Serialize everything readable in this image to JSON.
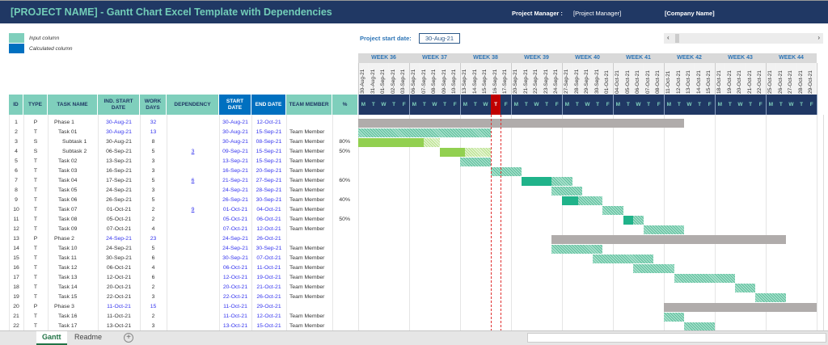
{
  "header": {
    "title": "[PROJECT NAME] - Gantt Chart Excel Template with Dependencies",
    "project_manager_label": "Project Manager :",
    "project_manager_value": "[Project Manager]",
    "company": "[Company Name]"
  },
  "legend": {
    "input_label": "Input column",
    "input_color": "#7fcfbc",
    "calculated_label": "Calculated column",
    "calculated_color": "#0070c0"
  },
  "project_start": {
    "label": "Project start date:",
    "value": "30-Aug-21"
  },
  "scroll": {
    "left": "‹",
    "right": "›"
  },
  "columns": [
    "ID",
    "TYPE",
    "TASK NAME",
    "IND. START DATE",
    "WORK DAYS",
    "DEPENDENCY",
    "START DATE",
    "END DATE",
    "TEAM MEMBER",
    "%"
  ],
  "weeks": [
    "WEEK 36",
    "WEEK 37",
    "WEEK 38",
    "WEEK 39",
    "WEEK 40",
    "WEEK 41",
    "WEEK 42",
    "WEEK 43",
    "WEEK 44"
  ],
  "dates": [
    "30-Aug-21",
    "31-Aug-21",
    "01-Sep-21",
    "02-Sep-21",
    "03-Sep-21",
    "06-Sep-21",
    "07-Sep-21",
    "08-Sep-21",
    "09-Sep-21",
    "10-Sep-21",
    "13-Sep-21",
    "14-Sep-21",
    "15-Sep-21",
    "16-Sep-21",
    "17-Sep-21",
    "20-Sep-21",
    "21-Sep-21",
    "22-Sep-21",
    "23-Sep-21",
    "24-Sep-21",
    "27-Sep-21",
    "28-Sep-21",
    "29-Sep-21",
    "30-Sep-21",
    "01-Oct-21",
    "04-Oct-21",
    "05-Oct-21",
    "06-Oct-21",
    "07-Oct-21",
    "08-Oct-21",
    "11-Oct-21",
    "12-Oct-21",
    "13-Oct-21",
    "14-Oct-21",
    "15-Oct-21",
    "18-Oct-21",
    "19-Oct-21",
    "20-Oct-21",
    "21-Oct-21",
    "22-Oct-21",
    "25-Oct-21",
    "26-Oct-21",
    "27-Oct-21",
    "28-Oct-21",
    "29-Oct-21"
  ],
  "day_letters": [
    "M",
    "T",
    "W",
    "T",
    "F"
  ],
  "today": "16-Sep-21",
  "colors": {
    "phase": "#b0acab",
    "task": "#20b38a",
    "subtask": "#92d050",
    "today": "#c00000",
    "header_bg": "#203864"
  },
  "rows": [
    {
      "id": "1",
      "type": "P",
      "name": "Phase 1",
      "ind_start": "30-Aug-21",
      "work_days": "32",
      "dependency": "",
      "start": "30-Aug-21",
      "end": "12-Oct-21",
      "member": "",
      "pct": "",
      "rollup": true
    },
    {
      "id": "2",
      "type": "T",
      "name": "Task 01",
      "ind_start": "30-Aug-21",
      "work_days": "13",
      "dependency": "",
      "start": "30-Aug-21",
      "end": "15-Sep-21",
      "member": "Team Member",
      "pct": "",
      "rollup": true
    },
    {
      "id": "3",
      "type": "S",
      "name": "Subtask 1",
      "ind_start": "30-Aug-21",
      "work_days": "8",
      "dependency": "",
      "start": "30-Aug-21",
      "end": "08-Sep-21",
      "member": "Team Member",
      "pct": "80%"
    },
    {
      "id": "4",
      "type": "S",
      "name": "Subtask 2",
      "ind_start": "06-Sep-21",
      "work_days": "5",
      "dependency": "3",
      "start": "09-Sep-21",
      "end": "15-Sep-21",
      "member": "Team Member",
      "pct": "50%"
    },
    {
      "id": "5",
      "type": "T",
      "name": "Task 02",
      "ind_start": "13-Sep-21",
      "work_days": "3",
      "dependency": "",
      "start": "13-Sep-21",
      "end": "15-Sep-21",
      "member": "Team Member",
      "pct": ""
    },
    {
      "id": "6",
      "type": "T",
      "name": "Task 03",
      "ind_start": "16-Sep-21",
      "work_days": "3",
      "dependency": "",
      "start": "16-Sep-21",
      "end": "20-Sep-21",
      "member": "Team Member",
      "pct": ""
    },
    {
      "id": "7",
      "type": "T",
      "name": "Task 04",
      "ind_start": "17-Sep-21",
      "work_days": "5",
      "dependency": "6",
      "start": "21-Sep-21",
      "end": "27-Sep-21",
      "member": "Team Member",
      "pct": "60%"
    },
    {
      "id": "8",
      "type": "T",
      "name": "Task 05",
      "ind_start": "24-Sep-21",
      "work_days": "3",
      "dependency": "",
      "start": "24-Sep-21",
      "end": "28-Sep-21",
      "member": "Team Member",
      "pct": ""
    },
    {
      "id": "9",
      "type": "T",
      "name": "Task 06",
      "ind_start": "26-Sep-21",
      "work_days": "5",
      "dependency": "",
      "start": "26-Sep-21",
      "end": "30-Sep-21",
      "member": "Team Member",
      "pct": "40%"
    },
    {
      "id": "10",
      "type": "T",
      "name": "Task 07",
      "ind_start": "01-Oct-21",
      "work_days": "2",
      "dependency": "9",
      "start": "01-Oct-21",
      "end": "04-Oct-21",
      "member": "Team Member",
      "pct": ""
    },
    {
      "id": "11",
      "type": "T",
      "name": "Task 08",
      "ind_start": "05-Oct-21",
      "work_days": "2",
      "dependency": "",
      "start": "05-Oct-21",
      "end": "06-Oct-21",
      "member": "Team Member",
      "pct": "50%"
    },
    {
      "id": "12",
      "type": "T",
      "name": "Task 09",
      "ind_start": "07-Oct-21",
      "work_days": "4",
      "dependency": "",
      "start": "07-Oct-21",
      "end": "12-Oct-21",
      "member": "Team Member",
      "pct": ""
    },
    {
      "id": "13",
      "type": "P",
      "name": "Phase 2",
      "ind_start": "24-Sep-21",
      "work_days": "23",
      "dependency": "",
      "start": "24-Sep-21",
      "end": "26-Oct-21",
      "member": "",
      "pct": "",
      "rollup": true
    },
    {
      "id": "14",
      "type": "T",
      "name": "Task 10",
      "ind_start": "24-Sep-21",
      "work_days": "5",
      "dependency": "",
      "start": "24-Sep-21",
      "end": "30-Sep-21",
      "member": "Team Member",
      "pct": ""
    },
    {
      "id": "15",
      "type": "T",
      "name": "Task 11",
      "ind_start": "30-Sep-21",
      "work_days": "6",
      "dependency": "",
      "start": "30-Sep-21",
      "end": "07-Oct-21",
      "member": "Team Member",
      "pct": ""
    },
    {
      "id": "16",
      "type": "T",
      "name": "Task 12",
      "ind_start": "06-Oct-21",
      "work_days": "4",
      "dependency": "",
      "start": "06-Oct-21",
      "end": "11-Oct-21",
      "member": "Team Member",
      "pct": ""
    },
    {
      "id": "17",
      "type": "T",
      "name": "Task 13",
      "ind_start": "12-Oct-21",
      "work_days": "6",
      "dependency": "",
      "start": "12-Oct-21",
      "end": "19-Oct-21",
      "member": "Team Member",
      "pct": ""
    },
    {
      "id": "18",
      "type": "T",
      "name": "Task 14",
      "ind_start": "20-Oct-21",
      "work_days": "2",
      "dependency": "",
      "start": "20-Oct-21",
      "end": "21-Oct-21",
      "member": "Team Member",
      "pct": ""
    },
    {
      "id": "19",
      "type": "T",
      "name": "Task 15",
      "ind_start": "22-Oct-21",
      "work_days": "3",
      "dependency": "",
      "start": "22-Oct-21",
      "end": "26-Oct-21",
      "member": "Team Member",
      "pct": ""
    },
    {
      "id": "20",
      "type": "P",
      "name": "Phase 3",
      "ind_start": "11-Oct-21",
      "work_days": "15",
      "dependency": "",
      "start": "11-Oct-21",
      "end": "29-Oct-21",
      "member": "",
      "pct": "",
      "rollup": true
    },
    {
      "id": "21",
      "type": "T",
      "name": "Task 16",
      "ind_start": "11-Oct-21",
      "work_days": "2",
      "dependency": "",
      "start": "11-Oct-21",
      "end": "12-Oct-21",
      "member": "Team Member",
      "pct": ""
    },
    {
      "id": "22",
      "type": "T",
      "name": "Task 17",
      "ind_start": "13-Oct-21",
      "work_days": "3",
      "dependency": "",
      "start": "13-Oct-21",
      "end": "15-Oct-21",
      "member": "Team Member",
      "pct": ""
    }
  ],
  "sheet_tabs": [
    "Gantt",
    "Readme"
  ],
  "add_sheet": "+"
}
